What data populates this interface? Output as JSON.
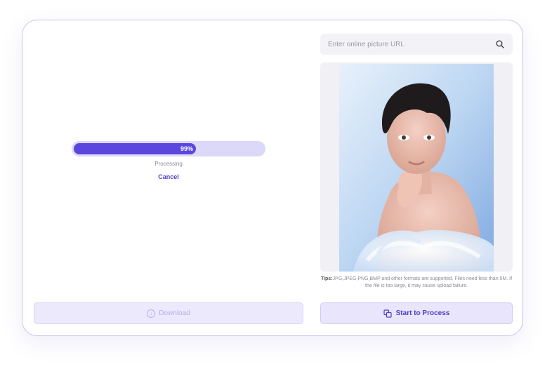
{
  "progress": {
    "percent": 99,
    "percent_label": "99%",
    "status": "Processing",
    "cancel_label": "Cancel"
  },
  "download": {
    "label": "Download",
    "icon": "download-circle-icon"
  },
  "url_search": {
    "placeholder": "Enter online picture URL",
    "value": "",
    "icon": "search-icon"
  },
  "preview": {
    "image": "portrait-photo"
  },
  "tips": {
    "prefix": "Tips:",
    "text": "JPG,JPEG,PNG,BMP and other formats are supported. Files need less than 5M. If the file is too large, it may cause upload failure."
  },
  "process": {
    "label": "Start to Process",
    "icon": "copy-process-icon"
  },
  "colors": {
    "accent": "#5b47de",
    "accent_text": "#4b3fc9",
    "progress_track": "#dcd8f8",
    "button_bg": "#e9e5fc",
    "card_border": "#c9c4f0"
  }
}
